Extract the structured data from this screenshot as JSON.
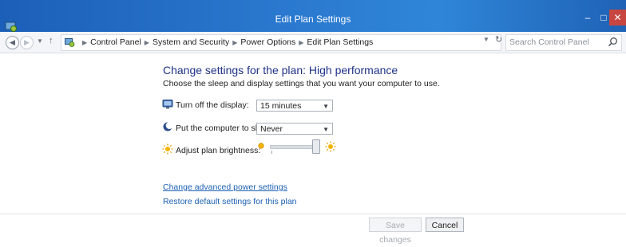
{
  "window": {
    "title": "Edit Plan Settings",
    "controls": {
      "minimize": "–",
      "maximize": "□",
      "close": "✕"
    }
  },
  "addressbar": {
    "breadcrumbs": [
      "Control Panel",
      "System and Security",
      "Power Options",
      "Edit Plan Settings"
    ],
    "search_placeholder": "Search Control Panel"
  },
  "main": {
    "heading": "Change settings for the plan: High performance",
    "subheading": "Choose the sleep and display settings that you want your computer to use.",
    "settings": {
      "display": {
        "label": "Turn off the display:",
        "value": "15 minutes"
      },
      "sleep": {
        "label": "Put the computer to sleep:",
        "value": "Never"
      },
      "brightness": {
        "label": "Adjust plan brightness:",
        "level_fraction": 0.95
      }
    },
    "links": {
      "advanced": "Change advanced power settings",
      "restore": "Restore default settings for this plan"
    }
  },
  "footer": {
    "save_label": "Save changes",
    "cancel_label": "Cancel"
  },
  "colors": {
    "titlebar": "#2a78cf",
    "heading": "#1e3287",
    "link": "#1a5fb4",
    "close_button": "#c7463f"
  }
}
